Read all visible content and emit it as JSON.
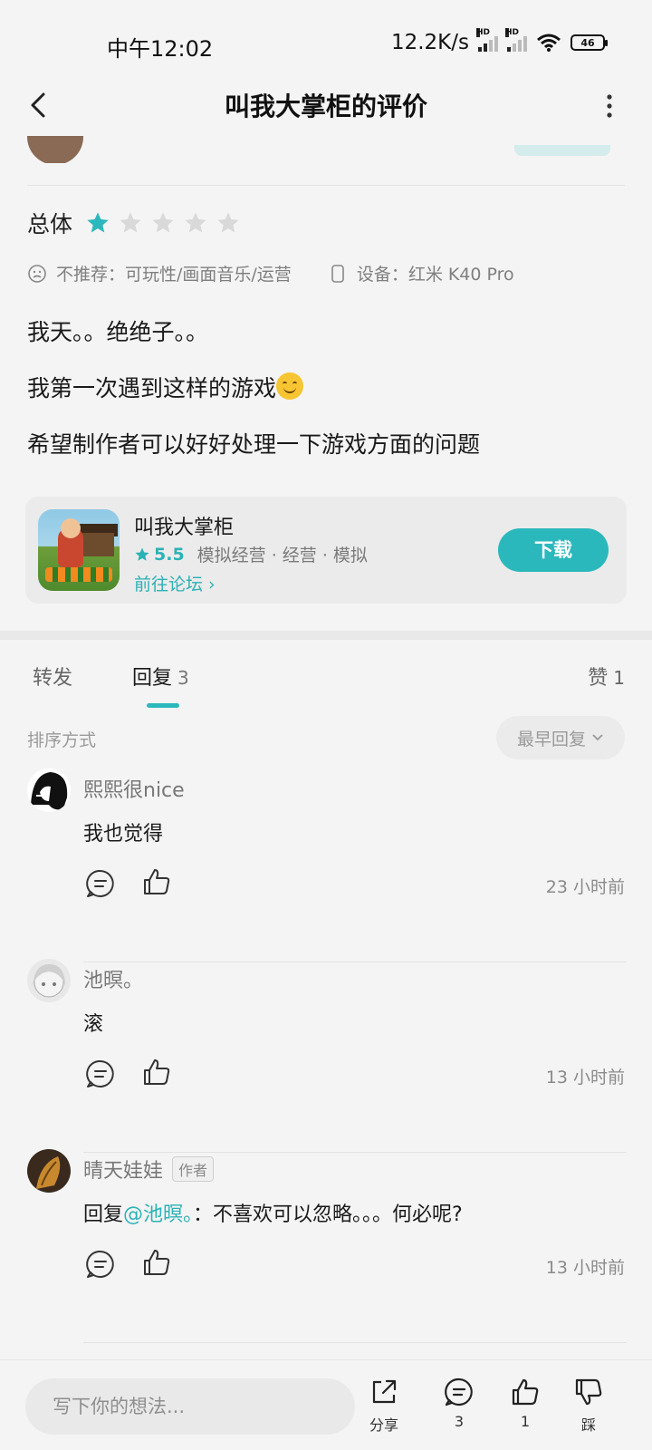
{
  "status_bar": {
    "time": "中午12:02",
    "net_speed": "12.2K/s",
    "signal_hd_1": "HD",
    "signal_hd_2": "HD",
    "battery": "46"
  },
  "header": {
    "title": "叫我大掌柜的评价"
  },
  "review": {
    "overall_label": "总体",
    "rating": 1,
    "max_rating": 5,
    "not_recommend": "不推荐：可玩性/画面音乐/运营",
    "device": "设备：红米 K40 Pro",
    "lines": [
      "我天。。绝绝子。。",
      "我第一次遇到这样的游戏",
      "希望制作者可以好好处理一下游戏方面的问题"
    ]
  },
  "game_card": {
    "name": "叫我大掌柜",
    "score": "5.5",
    "tags": "模拟经营 · 经营 · 模拟",
    "forum_link": "前往论坛 ›",
    "download_label": "下载"
  },
  "tabs": {
    "forward": "转发",
    "reply": "回复",
    "reply_count": "3",
    "like": "赞",
    "like_count": "1"
  },
  "sort": {
    "label": "排序方式",
    "selected": "最早回复"
  },
  "comments": [
    {
      "user": "熙熙很nice",
      "text": "我也觉得",
      "time": "23 小时前"
    },
    {
      "user": "池暝。",
      "text": "滚",
      "time": "13 小时前"
    },
    {
      "user": "晴天娃娃",
      "badge": "作者",
      "reply_prefix": "回复",
      "mention": "@池暝。",
      "text": "：不喜欢可以忽略。。。何必呢?",
      "time": "13 小时前"
    }
  ],
  "bottom_bar": {
    "input_placeholder": "写下你的想法...",
    "share_label": "分享",
    "comment_count": "3",
    "like_count": "1",
    "dislike_label": "踩"
  },
  "colors": {
    "accent": "#2bb8bd",
    "star_empty": "#d9d9d9",
    "background": "#f4f4f4"
  }
}
